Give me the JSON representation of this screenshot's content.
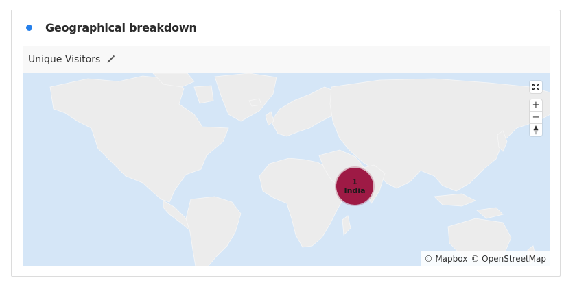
{
  "widget": {
    "title": "Geographical breakdown",
    "status_color": "#2680eb"
  },
  "metric": {
    "label": "Unique Visitors",
    "edit_icon": "pencil-icon"
  },
  "map": {
    "controls": {
      "fullscreen_icon": "fullscreen-icon",
      "zoom_in": "+",
      "zoom_out": "−",
      "compass_icon": "compass-icon"
    },
    "markers": [
      {
        "country": "India",
        "value": "1",
        "color": "#9e1a45"
      }
    ],
    "attribution": {
      "mapbox": "© Mapbox",
      "osm": "© OpenStreetMap"
    }
  }
}
